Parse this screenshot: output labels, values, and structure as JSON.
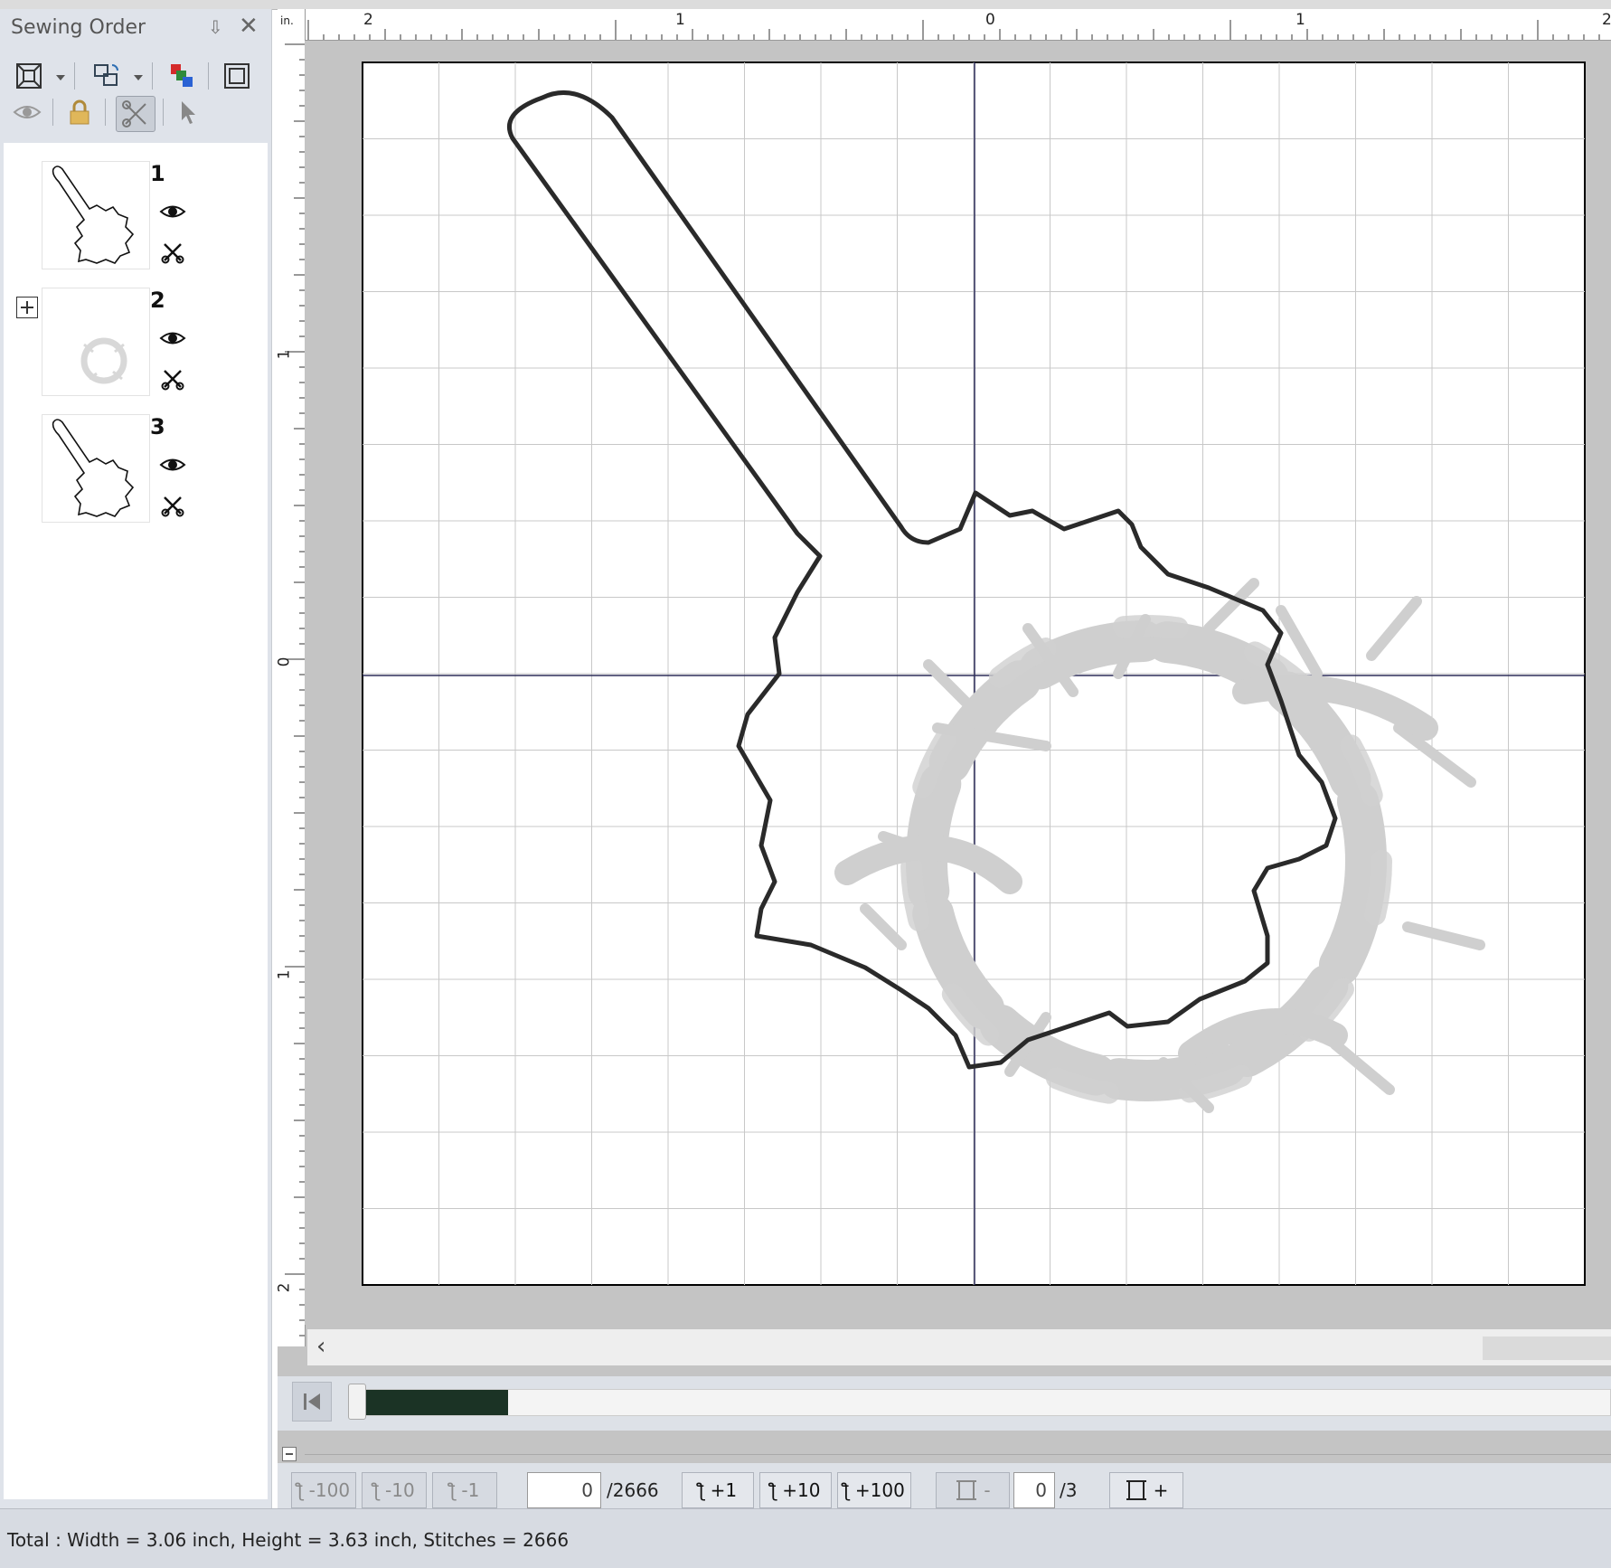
{
  "panel": {
    "title": "Sewing Order",
    "items": [
      {
        "number": "1"
      },
      {
        "number": "2"
      },
      {
        "number": "3"
      }
    ]
  },
  "ruler": {
    "unit": "in.",
    "top_labels": [
      "2",
      "1",
      "0",
      "1",
      "2"
    ],
    "left_labels": [
      "1",
      "0",
      "1",
      "2"
    ]
  },
  "stepbar": {
    "minus100": "-100",
    "minus10": "-10",
    "minus1": "-1",
    "stitch_value": "0",
    "stitch_total": "/2666",
    "plus1": "+1",
    "plus10": "+10",
    "plus100": "+100",
    "frame_minus": "-",
    "frame_value": "0",
    "frame_total": "/3",
    "frame_plus": "+"
  },
  "progress": {
    "fraction": 0.12
  },
  "status": {
    "text": "Total : Width = 3.06 inch, Height = 3.63 inch, Stitches = 2666"
  },
  "colors": {
    "progress_fill": "#1b3325",
    "outline": "#2a2a2a",
    "embroidery": "#c8c8c8"
  }
}
